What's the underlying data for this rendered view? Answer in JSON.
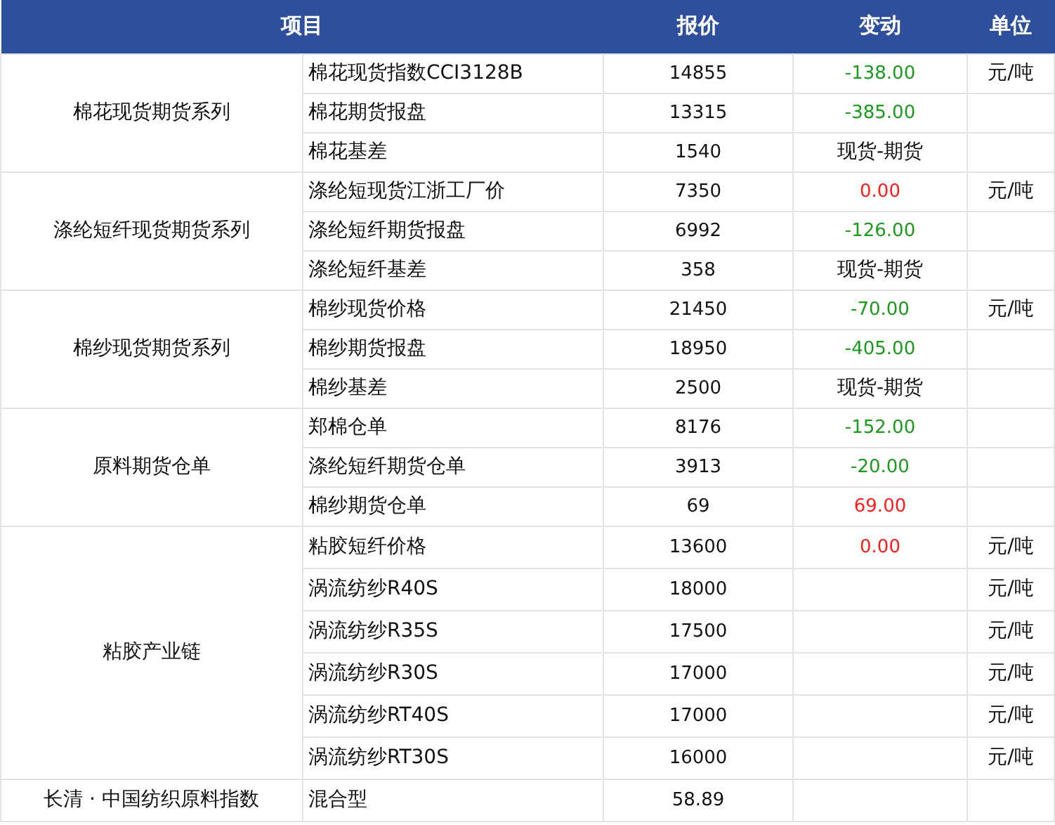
{
  "table": {
    "columns": [
      "项目",
      "报价",
      "变动",
      "单位"
    ],
    "groups": [
      {
        "name": "棉花现货期货系列",
        "rows": [
          {
            "item": "棉花现货指数CCI3128B",
            "price": "14855",
            "change": {
              "text": "-138.00",
              "kind": "down"
            },
            "unit": "元/吨"
          },
          {
            "item": "棉花期货报盘",
            "price": "13315",
            "change": {
              "text": "-385.00",
              "kind": "down"
            }
          },
          {
            "item": "棉花基差",
            "price": "1540",
            "change": {
              "text": "现货-期货",
              "kind": "note"
            }
          }
        ]
      },
      {
        "name": "涤纶短纤现货期货系列",
        "rows": [
          {
            "item": "涤纶短现货江浙工厂价",
            "price": "7350",
            "change": {
              "text": "0.00",
              "kind": "up"
            },
            "unit": "元/吨"
          },
          {
            "item": "涤纶短纤期货报盘",
            "price": "6992",
            "change": {
              "text": "-126.00",
              "kind": "down"
            }
          },
          {
            "item": "涤纶短纤基差",
            "price": "358",
            "change": {
              "text": "现货-期货",
              "kind": "note"
            }
          }
        ]
      },
      {
        "name": "棉纱现货期货系列",
        "rows": [
          {
            "item": "棉纱现货价格",
            "price": "21450",
            "change": {
              "text": "-70.00",
              "kind": "down"
            },
            "unit": "元/吨"
          },
          {
            "item": "棉纱期货报盘",
            "price": "18950",
            "change": {
              "text": "-405.00",
              "kind": "down"
            }
          },
          {
            "item": "棉纱基差",
            "price": "2500",
            "change": {
              "text": "现货-期货",
              "kind": "note"
            }
          }
        ]
      },
      {
        "name": "原料期货仓单",
        "rows": [
          {
            "item": "郑棉仓单",
            "price": "8176",
            "change": {
              "text": "-152.00",
              "kind": "down"
            }
          },
          {
            "item": "涤纶短纤期货仓单",
            "price": "3913",
            "change": {
              "text": "-20.00",
              "kind": "down"
            }
          },
          {
            "item": "棉纱期货仓单",
            "price": "69",
            "change": {
              "text": "69.00",
              "kind": "up"
            }
          }
        ]
      },
      {
        "name": "粘胶产业链",
        "rows": [
          {
            "item": "粘胶短纤价格",
            "price": "13600",
            "change": {
              "text": "0.00",
              "kind": "up"
            },
            "unit": "元/吨"
          },
          {
            "item": "涡流纺纱R40S",
            "price": "18000",
            "unit": "元/吨"
          },
          {
            "item": "涡流纺纱R35S",
            "price": "17500",
            "unit": "元/吨"
          },
          {
            "item": "涡流纺纱R30S",
            "price": "17000",
            "unit": "元/吨"
          },
          {
            "item": "涡流纺纱RT40S",
            "price": "17000",
            "unit": "元/吨"
          },
          {
            "item": "涡流纺纱RT30S",
            "price": "16000",
            "unit": "元/吨"
          }
        ]
      },
      {
        "name": "长清 · 中国纺织原料指数",
        "rows": [
          {
            "item": "混合型",
            "price": "58.89"
          }
        ]
      }
    ]
  }
}
